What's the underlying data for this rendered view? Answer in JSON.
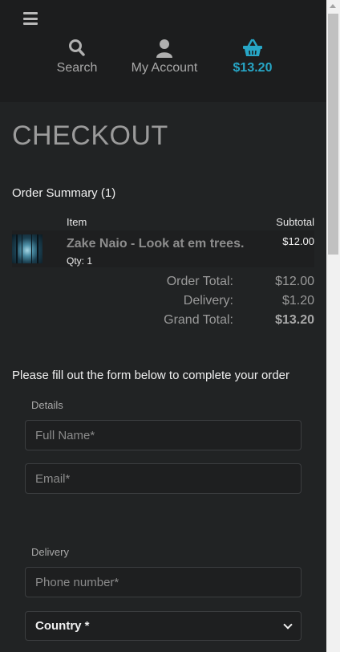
{
  "header": {
    "nav": [
      {
        "label": "Search",
        "icon": "search-icon"
      },
      {
        "label": "My Account",
        "icon": "user-icon"
      },
      {
        "label": "$13.20",
        "icon": "basket-icon"
      }
    ]
  },
  "page": {
    "title": "CHECKOUT"
  },
  "order_summary": {
    "heading": "Order Summary (1)",
    "columns": {
      "item": "Item",
      "subtotal": "Subtotal"
    },
    "items": [
      {
        "name": "Zake Naio - Look at em trees.",
        "qty": "Qty: 1",
        "price": "$12.00"
      }
    ],
    "totals": [
      {
        "label": "Order Total:",
        "value": "$12.00"
      },
      {
        "label": "Delivery:",
        "value": "$1.20"
      },
      {
        "label": "Grand Total:",
        "value": "$13.20"
      }
    ]
  },
  "form": {
    "intro": "Please fill out the form below to complete your order",
    "details_label": "Details",
    "full_name_placeholder": "Full Name*",
    "email_placeholder": "Email*",
    "delivery_label": "Delivery",
    "phone_placeholder": "Phone number*",
    "country_selected": "Country *"
  },
  "colors": {
    "accent": "#27a6c6",
    "background": "#212324",
    "header": "#1c1d1e"
  }
}
